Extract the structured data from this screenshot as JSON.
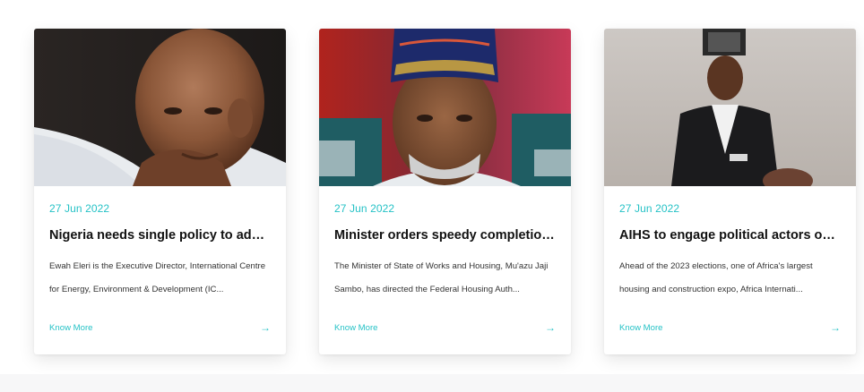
{
  "cards": [
    {
      "date": "27 Jun 2022",
      "title": "Nigeria needs single policy to addre...",
      "excerpt": "Ewah Eleri is the Executive Director, International Centre for Energy, Environment & Development (IC...",
      "more_label": "Know More",
      "arrow_icon": "arrow-right-icon"
    },
    {
      "date": "27 Jun 2022",
      "title": "Minister orders speedy completion ...",
      "excerpt": "The Minister of State of Works and Housing, Mu'azu Jaji Sambo, has directed the Federal Housing Auth...",
      "more_label": "Know More",
      "arrow_icon": "arrow-right-icon"
    },
    {
      "date": "27 Jun 2022",
      "title": "AIHS to engage political actors on h...",
      "excerpt": "Ahead of the 2023 elections, one of Africa's largest housing and construction expo, Africa Internati...",
      "more_label": "Know More",
      "arrow_icon": "arrow-right-icon"
    }
  ],
  "colors": {
    "accent": "#25c2c6",
    "title": "#111111",
    "text": "#333333"
  }
}
